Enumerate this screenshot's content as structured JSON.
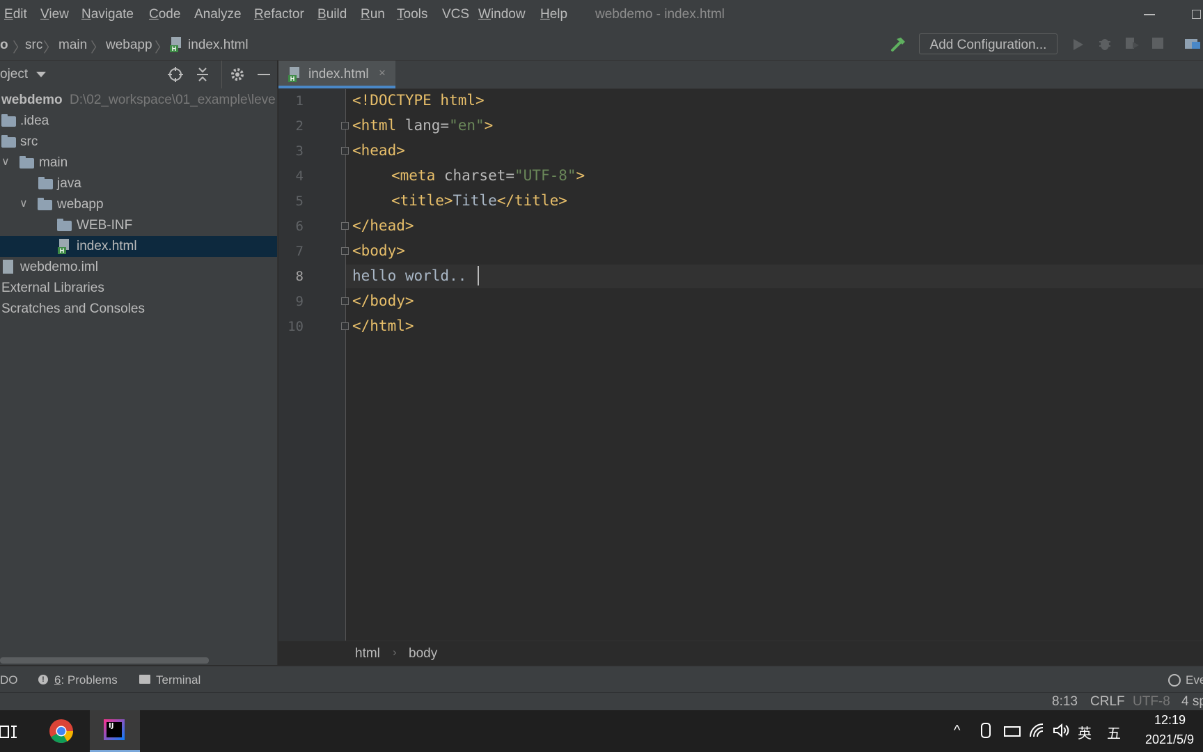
{
  "menu": {
    "items": [
      {
        "label": "Edit",
        "mnemonic": "E",
        "rest": "dit"
      },
      {
        "label": "View",
        "mnemonic": "V",
        "rest": "iew"
      },
      {
        "label": "Navigate",
        "mnemonic": "N",
        "rest": "avigate"
      },
      {
        "label": "Code",
        "mnemonic": "C",
        "rest": "ode"
      },
      {
        "label": "Analyze",
        "mnemonic": "",
        "rest": "Analyze"
      },
      {
        "label": "Refactor",
        "mnemonic": "R",
        "rest": "efactor"
      },
      {
        "label": "Build",
        "mnemonic": "B",
        "rest": "uild"
      },
      {
        "label": "Run",
        "mnemonic": "R",
        "rest": "un"
      },
      {
        "label": "Tools",
        "mnemonic": "T",
        "rest": "ools"
      },
      {
        "label": "VCS",
        "mnemonic": "",
        "rest": "VCS"
      },
      {
        "label": "Window",
        "mnemonic": "W",
        "rest": "indow"
      },
      {
        "label": "Help",
        "mnemonic": "H",
        "rest": "elp"
      }
    ],
    "window_title": "webdemo - index.html"
  },
  "navbar": {
    "breadcrumbs": [
      "o",
      "src",
      "main",
      "webapp",
      "index.html"
    ],
    "add_configuration": "Add Configuration..."
  },
  "project": {
    "title": "oject",
    "tree": [
      {
        "label": "webdemo",
        "path": "D:\\02_workspace\\01_example\\leve"
      },
      {
        "label": ".idea"
      },
      {
        "label": "src"
      },
      {
        "label": "main"
      },
      {
        "label": "java"
      },
      {
        "label": "webapp"
      },
      {
        "label": "WEB-INF"
      },
      {
        "label": "index.html"
      },
      {
        "label": "webdemo.iml"
      },
      {
        "label": "External Libraries"
      },
      {
        "label": "Scratches and Consoles"
      }
    ]
  },
  "editor": {
    "tab": "index.html",
    "line_numbers": [
      "1",
      "2",
      "3",
      "4",
      "5",
      "6",
      "7",
      "8",
      "9",
      "10"
    ],
    "lines": {
      "l1": {
        "t1": "<!DOCTYPE html>"
      },
      "l2": {
        "t1": "<html ",
        "a1": "lang=",
        "v1": "\"en\"",
        "t2": ">"
      },
      "l3": {
        "t1": "<head>"
      },
      "l4": {
        "t1": "<meta ",
        "a1": "charset=",
        "v1": "\"UTF-8\"",
        "t2": ">"
      },
      "l5": {
        "t1": "<title>",
        "x1": "Title",
        "t2": "</title>"
      },
      "l6": {
        "t1": "</head>"
      },
      "l7": {
        "t1": "<body>"
      },
      "l8": {
        "x1": "hello world.."
      },
      "l9": {
        "t1": "</body>"
      },
      "l10": {
        "t1": "</html>"
      }
    },
    "breadcrumbs": [
      "html",
      "body"
    ]
  },
  "toolwindows": {
    "todo": "DO",
    "problems_num": "6",
    "problems": ": Problems",
    "terminal": "Terminal",
    "event_log": "Eve"
  },
  "status": {
    "position": "8:13",
    "line_sep": "CRLF",
    "encoding": "UTF-8",
    "indent": "4 sp"
  },
  "taskbar": {
    "time": "12:19",
    "date": "2021/5/9",
    "ime_lang": "英",
    "ime_mode": "五"
  }
}
